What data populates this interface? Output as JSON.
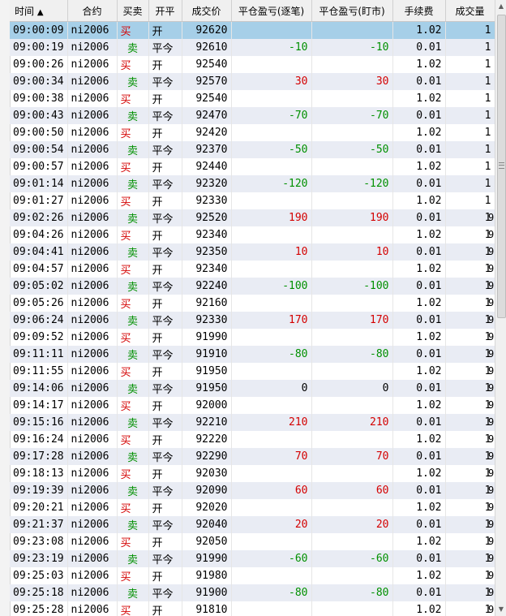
{
  "headers": {
    "time": "时间",
    "sort_icon": "▲",
    "contract": "合约",
    "side": "买卖",
    "offset": "开平",
    "price": "成交价",
    "pnl_trade": "平仓盈亏(逐笔)",
    "pnl_mark": "平仓盈亏(盯市)",
    "fee": "手续费",
    "volume": "成交量"
  },
  "side_labels": {
    "buy": "买",
    "sell": "卖"
  },
  "offset_labels": {
    "open": "开",
    "close_today": "平今"
  },
  "extra_col_value": "9",
  "rows": [
    {
      "time": "09:00:09",
      "contract": "ni2006",
      "side": "买",
      "offset": "开",
      "price": "92620",
      "pnl_trade": "",
      "pnl_mark": "",
      "fee": "1.02",
      "volume": "1",
      "extra": ""
    },
    {
      "time": "09:00:19",
      "contract": "ni2006",
      "side": "卖",
      "offset": "平今",
      "price": "92610",
      "pnl_trade": "-10",
      "pnl_mark": "-10",
      "fee": "0.01",
      "volume": "1",
      "extra": ""
    },
    {
      "time": "09:00:26",
      "contract": "ni2006",
      "side": "买",
      "offset": "开",
      "price": "92540",
      "pnl_trade": "",
      "pnl_mark": "",
      "fee": "1.02",
      "volume": "1",
      "extra": ""
    },
    {
      "time": "09:00:34",
      "contract": "ni2006",
      "side": "卖",
      "offset": "平今",
      "price": "92570",
      "pnl_trade": "30",
      "pnl_mark": "30",
      "fee": "0.01",
      "volume": "1",
      "extra": ""
    },
    {
      "time": "09:00:38",
      "contract": "ni2006",
      "side": "买",
      "offset": "开",
      "price": "92540",
      "pnl_trade": "",
      "pnl_mark": "",
      "fee": "1.02",
      "volume": "1",
      "extra": ""
    },
    {
      "time": "09:00:43",
      "contract": "ni2006",
      "side": "卖",
      "offset": "平今",
      "price": "92470",
      "pnl_trade": "-70",
      "pnl_mark": "-70",
      "fee": "0.01",
      "volume": "1",
      "extra": ""
    },
    {
      "time": "09:00:50",
      "contract": "ni2006",
      "side": "买",
      "offset": "开",
      "price": "92420",
      "pnl_trade": "",
      "pnl_mark": "",
      "fee": "1.02",
      "volume": "1",
      "extra": ""
    },
    {
      "time": "09:00:54",
      "contract": "ni2006",
      "side": "卖",
      "offset": "平今",
      "price": "92370",
      "pnl_trade": "-50",
      "pnl_mark": "-50",
      "fee": "0.01",
      "volume": "1",
      "extra": ""
    },
    {
      "time": "09:00:57",
      "contract": "ni2006",
      "side": "买",
      "offset": "开",
      "price": "92440",
      "pnl_trade": "",
      "pnl_mark": "",
      "fee": "1.02",
      "volume": "1",
      "extra": ""
    },
    {
      "time": "09:01:14",
      "contract": "ni2006",
      "side": "卖",
      "offset": "平今",
      "price": "92320",
      "pnl_trade": "-120",
      "pnl_mark": "-120",
      "fee": "0.01",
      "volume": "1",
      "extra": ""
    },
    {
      "time": "09:01:27",
      "contract": "ni2006",
      "side": "买",
      "offset": "开",
      "price": "92330",
      "pnl_trade": "",
      "pnl_mark": "",
      "fee": "1.02",
      "volume": "1",
      "extra": ""
    },
    {
      "time": "09:02:26",
      "contract": "ni2006",
      "side": "卖",
      "offset": "平今",
      "price": "92520",
      "pnl_trade": "190",
      "pnl_mark": "190",
      "fee": "0.01",
      "volume": "1",
      "extra": "9"
    },
    {
      "time": "09:04:26",
      "contract": "ni2006",
      "side": "买",
      "offset": "开",
      "price": "92340",
      "pnl_trade": "",
      "pnl_mark": "",
      "fee": "1.02",
      "volume": "1",
      "extra": "9"
    },
    {
      "time": "09:04:41",
      "contract": "ni2006",
      "side": "卖",
      "offset": "平今",
      "price": "92350",
      "pnl_trade": "10",
      "pnl_mark": "10",
      "fee": "0.01",
      "volume": "1",
      "extra": "9"
    },
    {
      "time": "09:04:57",
      "contract": "ni2006",
      "side": "买",
      "offset": "开",
      "price": "92340",
      "pnl_trade": "",
      "pnl_mark": "",
      "fee": "1.02",
      "volume": "1",
      "extra": "9"
    },
    {
      "time": "09:05:02",
      "contract": "ni2006",
      "side": "卖",
      "offset": "平今",
      "price": "92240",
      "pnl_trade": "-100",
      "pnl_mark": "-100",
      "fee": "0.01",
      "volume": "1",
      "extra": "9"
    },
    {
      "time": "09:05:26",
      "contract": "ni2006",
      "side": "买",
      "offset": "开",
      "price": "92160",
      "pnl_trade": "",
      "pnl_mark": "",
      "fee": "1.02",
      "volume": "1",
      "extra": "9"
    },
    {
      "time": "09:06:24",
      "contract": "ni2006",
      "side": "卖",
      "offset": "平今",
      "price": "92330",
      "pnl_trade": "170",
      "pnl_mark": "170",
      "fee": "0.01",
      "volume": "1",
      "extra": "9"
    },
    {
      "time": "09:09:52",
      "contract": "ni2006",
      "side": "买",
      "offset": "开",
      "price": "91990",
      "pnl_trade": "",
      "pnl_mark": "",
      "fee": "1.02",
      "volume": "1",
      "extra": "9"
    },
    {
      "time": "09:11:11",
      "contract": "ni2006",
      "side": "卖",
      "offset": "平今",
      "price": "91910",
      "pnl_trade": "-80",
      "pnl_mark": "-80",
      "fee": "0.01",
      "volume": "1",
      "extra": "9"
    },
    {
      "time": "09:11:55",
      "contract": "ni2006",
      "side": "买",
      "offset": "开",
      "price": "91950",
      "pnl_trade": "",
      "pnl_mark": "",
      "fee": "1.02",
      "volume": "1",
      "extra": "9"
    },
    {
      "time": "09:14:06",
      "contract": "ni2006",
      "side": "卖",
      "offset": "平今",
      "price": "91950",
      "pnl_trade": "0",
      "pnl_mark": "0",
      "fee": "0.01",
      "volume": "1",
      "extra": "9"
    },
    {
      "time": "09:14:17",
      "contract": "ni2006",
      "side": "买",
      "offset": "开",
      "price": "92000",
      "pnl_trade": "",
      "pnl_mark": "",
      "fee": "1.02",
      "volume": "1",
      "extra": "9"
    },
    {
      "time": "09:15:16",
      "contract": "ni2006",
      "side": "卖",
      "offset": "平今",
      "price": "92210",
      "pnl_trade": "210",
      "pnl_mark": "210",
      "fee": "0.01",
      "volume": "1",
      "extra": "9"
    },
    {
      "time": "09:16:24",
      "contract": "ni2006",
      "side": "买",
      "offset": "开",
      "price": "92220",
      "pnl_trade": "",
      "pnl_mark": "",
      "fee": "1.02",
      "volume": "1",
      "extra": "9"
    },
    {
      "time": "09:17:28",
      "contract": "ni2006",
      "side": "卖",
      "offset": "平今",
      "price": "92290",
      "pnl_trade": "70",
      "pnl_mark": "70",
      "fee": "0.01",
      "volume": "1",
      "extra": "9"
    },
    {
      "time": "09:18:13",
      "contract": "ni2006",
      "side": "买",
      "offset": "开",
      "price": "92030",
      "pnl_trade": "",
      "pnl_mark": "",
      "fee": "1.02",
      "volume": "1",
      "extra": "9"
    },
    {
      "time": "09:19:39",
      "contract": "ni2006",
      "side": "卖",
      "offset": "平今",
      "price": "92090",
      "pnl_trade": "60",
      "pnl_mark": "60",
      "fee": "0.01",
      "volume": "1",
      "extra": "9"
    },
    {
      "time": "09:20:21",
      "contract": "ni2006",
      "side": "买",
      "offset": "开",
      "price": "92020",
      "pnl_trade": "",
      "pnl_mark": "",
      "fee": "1.02",
      "volume": "1",
      "extra": "9"
    },
    {
      "time": "09:21:37",
      "contract": "ni2006",
      "side": "卖",
      "offset": "平今",
      "price": "92040",
      "pnl_trade": "20",
      "pnl_mark": "20",
      "fee": "0.01",
      "volume": "1",
      "extra": "9"
    },
    {
      "time": "09:23:08",
      "contract": "ni2006",
      "side": "买",
      "offset": "开",
      "price": "92050",
      "pnl_trade": "",
      "pnl_mark": "",
      "fee": "1.02",
      "volume": "1",
      "extra": "9"
    },
    {
      "time": "09:23:19",
      "contract": "ni2006",
      "side": "卖",
      "offset": "平今",
      "price": "91990",
      "pnl_trade": "-60",
      "pnl_mark": "-60",
      "fee": "0.01",
      "volume": "1",
      "extra": "9"
    },
    {
      "time": "09:25:03",
      "contract": "ni2006",
      "side": "买",
      "offset": "开",
      "price": "91980",
      "pnl_trade": "",
      "pnl_mark": "",
      "fee": "1.02",
      "volume": "1",
      "extra": "9"
    },
    {
      "time": "09:25:18",
      "contract": "ni2006",
      "side": "卖",
      "offset": "平今",
      "price": "91900",
      "pnl_trade": "-80",
      "pnl_mark": "-80",
      "fee": "0.01",
      "volume": "1",
      "extra": "9"
    },
    {
      "time": "09:25:28",
      "contract": "ni2006",
      "side": "买",
      "offset": "开",
      "price": "91810",
      "pnl_trade": "",
      "pnl_mark": "",
      "fee": "1.02",
      "volume": "1",
      "extra": "9"
    }
  ],
  "colors": {
    "buy": "#d40000",
    "sell": "#009000",
    "selected_row": "#a6cfe8",
    "alt_row": "#e9ecf4",
    "header_bg": "#f0f0f0"
  },
  "icons": {
    "sort": "sort-asc-icon",
    "scroll_up": "scroll-up-arrow-icon",
    "scroll_down": "scroll-down-arrow-icon",
    "grip": "scroll-grip-icon"
  }
}
